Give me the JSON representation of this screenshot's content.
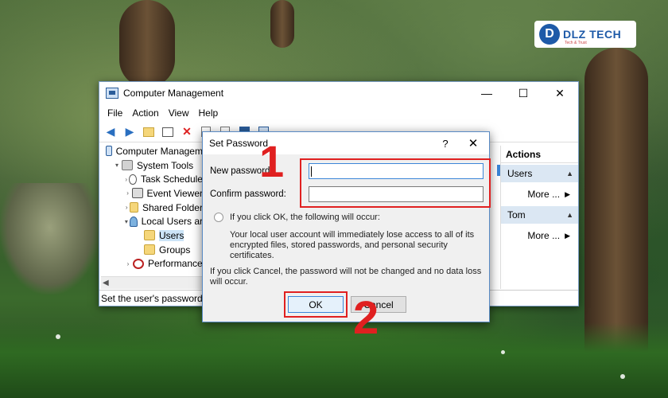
{
  "logo": {
    "text": "DLZ TECH",
    "mark": "D",
    "tagline": "Tech & Trust"
  },
  "window": {
    "title": "Computer Management",
    "controls": [
      "—",
      "☐",
      "✕"
    ],
    "menu": [
      "File",
      "Action",
      "View",
      "Help"
    ],
    "status": "Set the user's password."
  },
  "tree": [
    {
      "label": "Computer Managem",
      "icon": "computer-icon",
      "indent": 0,
      "expander": ""
    },
    {
      "label": "System Tools",
      "icon": "tools-icon",
      "indent": 1,
      "expander": "▾"
    },
    {
      "label": "Task Schedule",
      "icon": "clock-icon",
      "indent": 2,
      "expander": "›"
    },
    {
      "label": "Event Viewer",
      "icon": "event-viewer-icon",
      "indent": 2,
      "expander": "›"
    },
    {
      "label": "Shared Folder",
      "icon": "folder-icon",
      "indent": 2,
      "expander": "›"
    },
    {
      "label": "Local Users ar",
      "icon": "users-icon",
      "indent": 2,
      "expander": "▾"
    },
    {
      "label": "Users",
      "icon": "folder-icon",
      "indent": 3,
      "expander": "",
      "selected": true
    },
    {
      "label": "Groups",
      "icon": "folder-icon",
      "indent": 3,
      "expander": ""
    },
    {
      "label": "Performance",
      "icon": "performance-icon",
      "indent": 2,
      "expander": "›"
    }
  ],
  "actions": {
    "heading": "Actions",
    "sections": [
      {
        "title": "Users",
        "more": "More ..."
      },
      {
        "title": "Tom",
        "more": "More ..."
      }
    ]
  },
  "dialog": {
    "title": "Set Password",
    "help": "?",
    "close": "✕",
    "new_password_label": "New password:",
    "confirm_password_label": "Confirm password:",
    "new_password_value": "",
    "confirm_password_value": "",
    "ok_heading": "If you click OK, the following will occur:",
    "ok_detail": "Your local user account will immediately lose access to all of its encrypted files, stored passwords, and personal security certificates.",
    "cancel_text": "If you click Cancel, the password will not be changed and no data loss will occur.",
    "ok_button": "OK",
    "cancel_button": "Cancel"
  },
  "annotations": {
    "step1": "1",
    "step2": "2"
  },
  "colors": {
    "highlight": "#e02020",
    "accent": "#3b86d8",
    "brand": "#1e5aa8"
  }
}
